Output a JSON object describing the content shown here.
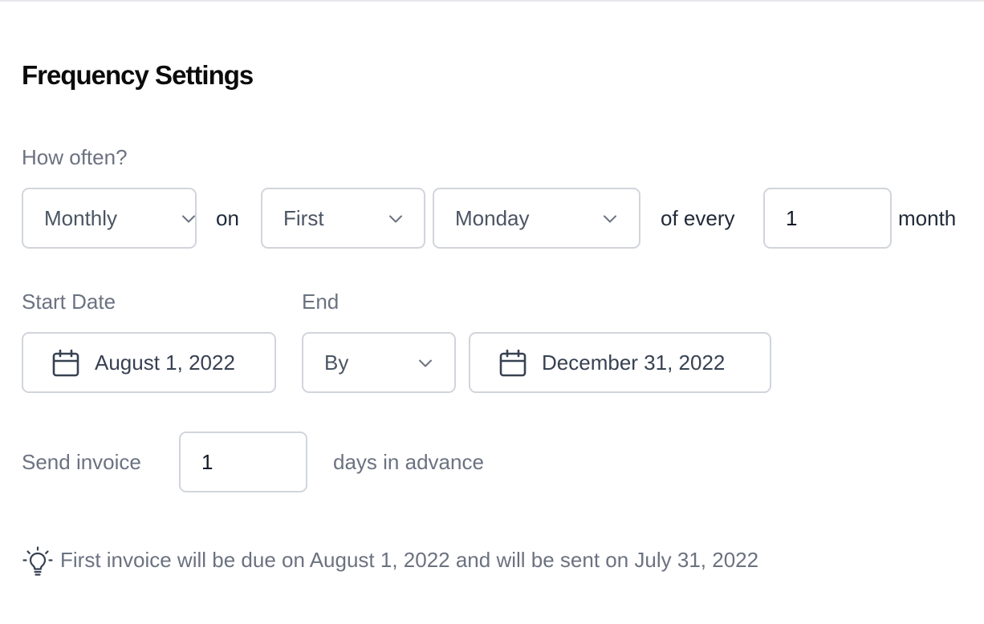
{
  "section": {
    "title": "Frequency Settings"
  },
  "frequency": {
    "label": "How often?",
    "interval_select": "Monthly",
    "on_text": "on",
    "ordinal_select": "First",
    "weekday_select": "Monday",
    "of_every_text": "of every",
    "count_value": "1",
    "unit_text": "month"
  },
  "dates": {
    "start_label": "Start Date",
    "start_value": "August 1, 2022",
    "end_label": "End",
    "end_mode_select": "By",
    "end_value": "December 31, 2022"
  },
  "advance": {
    "label": "Send invoice",
    "days_value": "1",
    "suffix": "days in advance"
  },
  "hint": {
    "icon": "lightbulb-icon",
    "text": "First invoice will be due on August 1, 2022 and will be sent on July 31, 2022"
  },
  "colors": {
    "label_gray": "#6b7280",
    "border_gray": "#d1d5db",
    "title_black": "#0b0b0b"
  }
}
